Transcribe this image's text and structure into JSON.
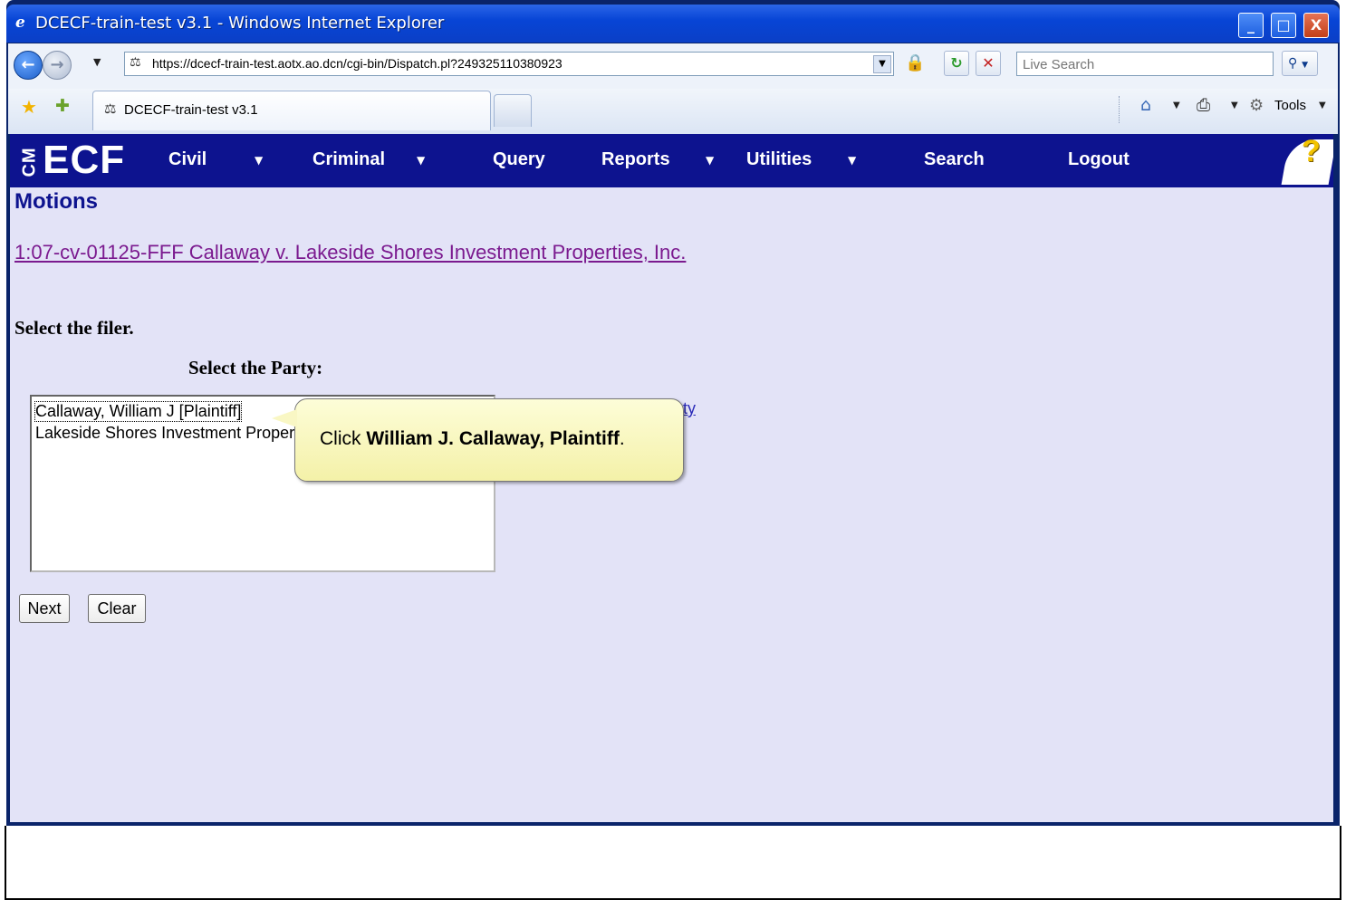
{
  "window": {
    "title": "DCECF-train-test v3.1 - Windows Internet Explorer",
    "minimize": "_",
    "maximize": "□",
    "close": "X"
  },
  "addressbar": {
    "url": "https://dcecf-train-test.aotx.ao.dcn/cgi-bin/Dispatch.pl?249325110380923",
    "search_placeholder": "Live Search"
  },
  "tabs": {
    "active_label": "DCECF-train-test v3.1"
  },
  "commandbar": {
    "tools_label": "Tools"
  },
  "ecf": {
    "logo": "ECF",
    "logo_prefix": "CM",
    "menu": {
      "civil": "Civil",
      "criminal": "Criminal",
      "query": "Query",
      "reports": "Reports",
      "utilities": "Utilities",
      "search": "Search",
      "logout": "Logout"
    },
    "help": "?"
  },
  "page": {
    "heading": "Motions",
    "case_link": "1:07-cv-01125-FFF Callaway v. Lakeside Shores Investment Properties, Inc.",
    "filer_label": "Select the filer.",
    "party_label": "Select the Party:",
    "parties": [
      "Callaway, William J [Plaintiff]",
      "Lakeside Shores Investment Properties, Inc. [Defendant]"
    ],
    "new_party_link": "Add/Create New Party",
    "next_button": "Next",
    "clear_button": "Clear"
  },
  "callout": {
    "prefix": "Click ",
    "emphasis": "William J. Callaway, Plaintiff",
    "suffix": "."
  }
}
